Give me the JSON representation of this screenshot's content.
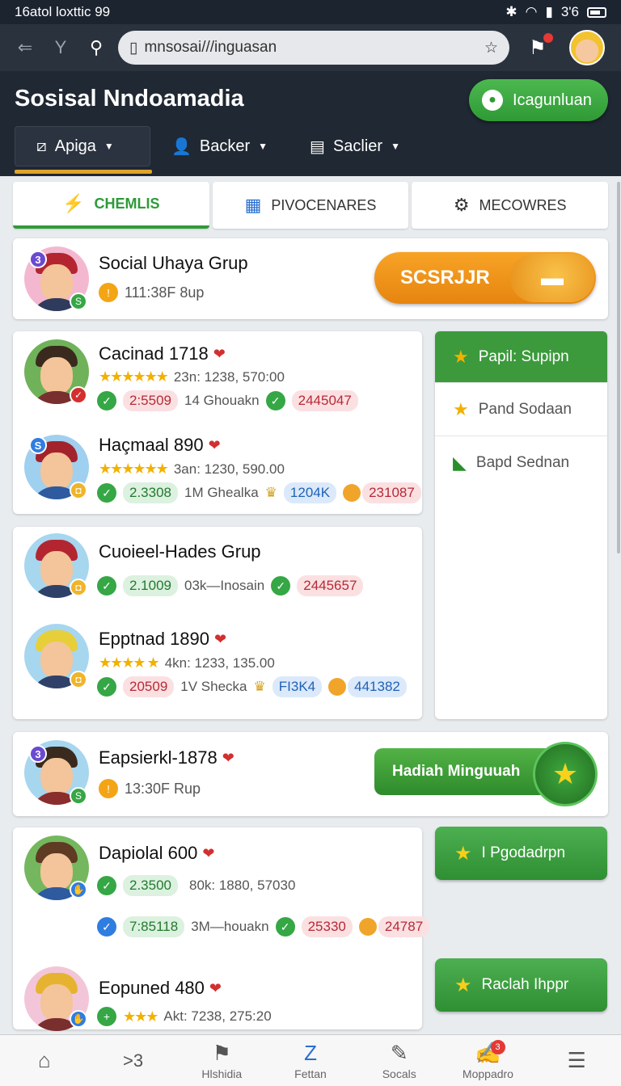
{
  "status_bar": {
    "time": "16atol loxttic 99",
    "battery": "3'6"
  },
  "browser": {
    "url": "mnsosai///inguasan"
  },
  "app": {
    "title": "Sosisal Nndoamadia",
    "header_button": "Icagunluan",
    "menu_tabs": [
      {
        "label": "Apiga",
        "icon": "chart-icon"
      },
      {
        "label": "Backer",
        "icon": "person-icon"
      },
      {
        "label": "Saclier",
        "icon": "card-icon"
      }
    ]
  },
  "segment_tabs": [
    {
      "label": "CHEMLIS",
      "icon": "lightning-icon"
    },
    {
      "label": "PIVOCENARES",
      "icon": "calculator-icon"
    },
    {
      "label": "MECOWRES",
      "icon": "gear-icon"
    }
  ],
  "cards": {
    "top": {
      "name": "Social Uhaya Grup",
      "sub": "111:38F 8up",
      "badge": "3",
      "button": "SCSRJJR"
    },
    "c1": {
      "name": "Cacinad 1718",
      "meta": "23n: 1238, 570:00",
      "p1": "2:5509",
      "text": "14 Ghouakn",
      "p2": "2445047"
    },
    "c2": {
      "name": "Haçmaal 890",
      "meta": "3an: 1230, 590.00",
      "p1": "2.3308",
      "text": "1M Ghealka",
      "p2": "1204K",
      "p3": "231087",
      "badge": "S"
    },
    "c3": {
      "name": "Cuoieel-Hades Grup",
      "p1": "2.1009",
      "text": "03k—Inosain",
      "p2": "2445657"
    },
    "c4": {
      "name": "Epptnad 1890",
      "meta": "4kn: 1233, 135.00",
      "p1": "20509",
      "text": "1V Shecka",
      "p2": "FI3K4",
      "p3": "441382"
    },
    "c5": {
      "name": "Eapsierkl-1878",
      "sub": "13:30F Rup",
      "badge": "3",
      "button": "Hadiah Minguuah"
    },
    "c6": {
      "name": "Dapiolal 600",
      "p1": "2.3500",
      "meta": "80k: 1880, 57030",
      "p2": "7:85118",
      "text": "3M—houakn",
      "p3": "25330",
      "p4": "24787"
    },
    "c7": {
      "name": "Eopuned 480",
      "meta": "Akt: 7238, 275:20"
    }
  },
  "side_panel": [
    {
      "label": "Papil: Supipn",
      "icon": "star-icon"
    },
    {
      "label": "Pand Sodaan",
      "icon": "star-icon"
    },
    {
      "label": "Bapd Sednan",
      "icon": "leaf-icon"
    }
  ],
  "side_buttons": [
    {
      "label": "I Pgodadrpn",
      "icon": "star-icon"
    },
    {
      "label": "Raclah Ihppr",
      "icon": "star-icon"
    }
  ],
  "bottom_nav": [
    {
      "label": "",
      "icon": "home-icon"
    },
    {
      "label": "",
      "icon": "forward-icon",
      "glyph": ">3"
    },
    {
      "label": "Hlshidia",
      "icon": "flag-icon"
    },
    {
      "label": "Fettan",
      "icon": "zoom-icon"
    },
    {
      "label": "Socals",
      "icon": "feather-icon"
    },
    {
      "label": "Moppadro",
      "icon": "edit-icon",
      "badge": "3"
    },
    {
      "label": "",
      "icon": "menu-icon"
    }
  ]
}
